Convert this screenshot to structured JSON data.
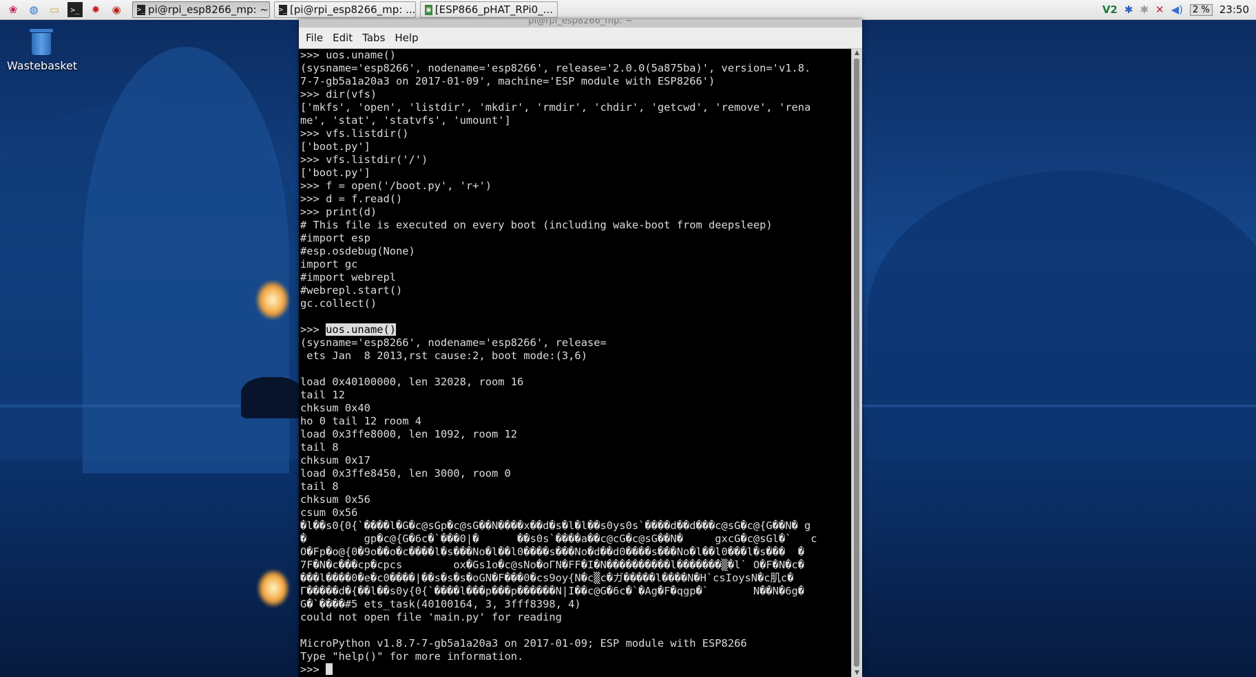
{
  "taskbar": {
    "launchers": [
      {
        "icon": "raspberry-menu-icon",
        "glyph": "❀"
      },
      {
        "icon": "web-browser-icon",
        "glyph": "◍"
      },
      {
        "icon": "file-manager-icon",
        "glyph": "▭"
      },
      {
        "icon": "terminal-icon",
        "glyph": ">_"
      },
      {
        "icon": "wolfram-icon",
        "glyph": "✸"
      },
      {
        "icon": "mathematica-icon",
        "glyph": "◉"
      }
    ],
    "tasks": [
      {
        "label": "pi@rpi_esp8266_mp: ~",
        "active": true,
        "icon": "terminal-icon"
      },
      {
        "label": "[pi@rpi_esp8266_mp: ...",
        "active": false,
        "icon": "terminal-icon"
      },
      {
        "label": "[ESP866_pHAT_RPi0_...",
        "active": false,
        "icon": "image-viewer-icon"
      }
    ],
    "tray": {
      "cpu": "2 %",
      "clock": "23:50"
    }
  },
  "desktop": {
    "trash_label": "Wastebasket"
  },
  "window": {
    "title": "pi@rpi_esp8266_mp: ~",
    "menu": [
      "File",
      "Edit",
      "Tabs",
      "Help"
    ]
  },
  "terminal": {
    "lines": [
      ">>> uos.uname()",
      "(sysname='esp8266', nodename='esp8266', release='2.0.0(5a875ba)', version='v1.8.",
      "7-7-gb5a1a20a3 on 2017-01-09', machine='ESP module with ESP8266')",
      ">>> dir(vfs)",
      "['mkfs', 'open', 'listdir', 'mkdir', 'rmdir', 'chdir', 'getcwd', 'remove', 'rena",
      "me', 'stat', 'statvfs', 'umount']",
      ">>> vfs.listdir()",
      "['boot.py']",
      ">>> vfs.listdir('/')",
      "['boot.py']",
      ">>> f = open('/boot.py', 'r+')",
      ">>> d = f.read()",
      ">>> print(d)",
      "# This file is executed on every boot (including wake-boot from deepsleep)",
      "#import esp",
      "#esp.osdebug(None)",
      "import gc",
      "#import webrepl",
      "#webrepl.start()",
      "gc.collect()",
      "",
      "__SEL__",
      "(sysname='esp8266', nodename='esp8266', release=",
      " ets Jan  8 2013,rst cause:2, boot mode:(3,6)",
      "",
      "load 0x40100000, len 32028, room 16",
      "tail 12",
      "chksum 0x40",
      "ho 0 tail 12 room 4",
      "load 0x3ffe8000, len 1092, room 12",
      "tail 8",
      "chksum 0x17",
      "load 0x3ffe8450, len 3000, room 0",
      "tail 8",
      "chksum 0x56",
      "csum 0x56",
      "�l��s0{0{`����l�G�c@sGp�c@sG��N����x��d�s�l�l��s0ys0s`����d��d���c@sG�c@{G��N� g",
      "�         gp�c@{G�6c�`���0|�      ��s0s`����a��c@cG�c@sG��N�     gxcG�c@sGl�`   c",
      "O�Fp�o@{0�9o��o�c����l�s���No�l��l0����s���No�d��d0����s���No�l��l0���l�s���  �",
      "7F�N�c���cp�cpcs        ox�Gs1o�c@sNo�oΓN�FF�I�N����������l�������▒�l` O�F�N�c�",
      "���l����0�e�c0����|��s�s�s�oGN�F���0�cs9oy{N�c▒c�ガ�����l����N�H`csIoysN�c肌c�",
      "Γ�����d�{��l��s0y{0{`����l���p���p������N|I��c@G�6c�`�Ag�F�qgp�`       N��N�6g�",
      "G�`����#5 ets_task(40100164, 3, 3fff8398, 4)",
      "could not open file 'main.py' for reading",
      "",
      "MicroPython v1.8.7-7-gb5a1a20a3 on 2017-01-09; ESP module with ESP8266",
      "Type \"help()\" for more information.",
      "__PROMPT__"
    ],
    "selected_prompt": ">>> ",
    "selected_command": "uos.uname()",
    "prompt": ">>> "
  },
  "colors": {
    "terminal_bg": "#000000",
    "terminal_fg": "#dcdcdc",
    "taskbar_bg": "#ececec"
  }
}
